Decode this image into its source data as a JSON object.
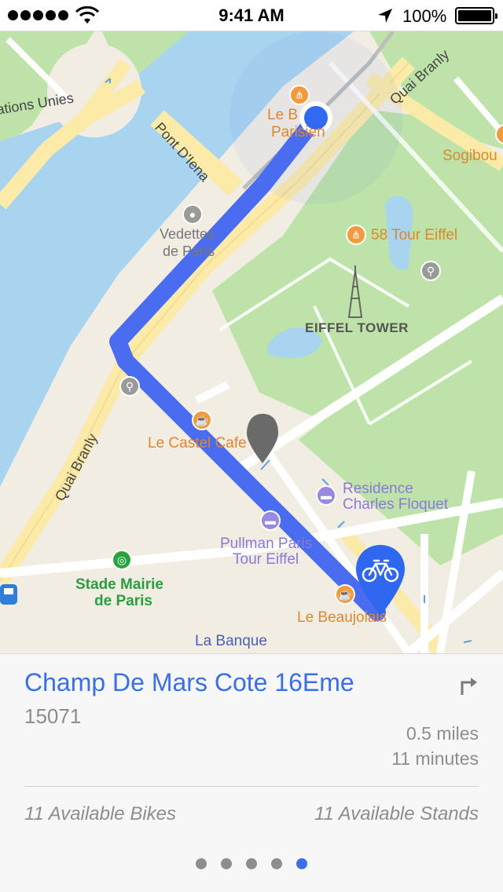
{
  "status_bar": {
    "time": "9:41 AM",
    "battery_text": "100%",
    "signal_dots": 5,
    "icons": [
      "signal-dots-icon",
      "wifi-icon",
      "location-arrow-icon",
      "battery-icon"
    ]
  },
  "map": {
    "labels": {
      "nations_unies": "ations Unies",
      "pont_diena": "Pont D'Iena",
      "quai_branly_top": "Quai Branly",
      "quai_branly_left": "Quai Branly",
      "le_b": "Le B",
      "parisien": "Parisien",
      "sogibou": "Sogibou",
      "vedettes": "Vedettes",
      "de_paris": "de Paris",
      "tour_eiffel_58": "58 Tour Eiffel",
      "eiffel_tower": "EIFFEL TOWER",
      "le_castel_cafe": "Le Castel Cafe",
      "residence": "Residence",
      "charles_floquet": "Charles Floquet",
      "pullman_paris": "Pullman Paris",
      "tour_eiffel": "Tour Eiffel",
      "stade_mairie": "Stade Mairie",
      "de_paris_stade": "de Paris",
      "le_beaujolais": "Le Beaujolais",
      "la_banque": "La Banque"
    },
    "colors": {
      "route": "#4a6cf0",
      "water": "#a9d4ef",
      "park": "#bde3a8",
      "road": "#ffffff",
      "main_road": "#fbeaa8",
      "land": "#f2ede3",
      "bike_pin": "#2f67f0",
      "user_dot": "#2f6af0"
    }
  },
  "card": {
    "station_name": "Champ De Mars Cote 16Eme",
    "station_id": "15071",
    "distance": "0.5 miles",
    "duration": "11 minutes",
    "bikes": "11 Available Bikes",
    "stands": "11 Available Stands",
    "page_count": 5,
    "active_page": 5
  }
}
